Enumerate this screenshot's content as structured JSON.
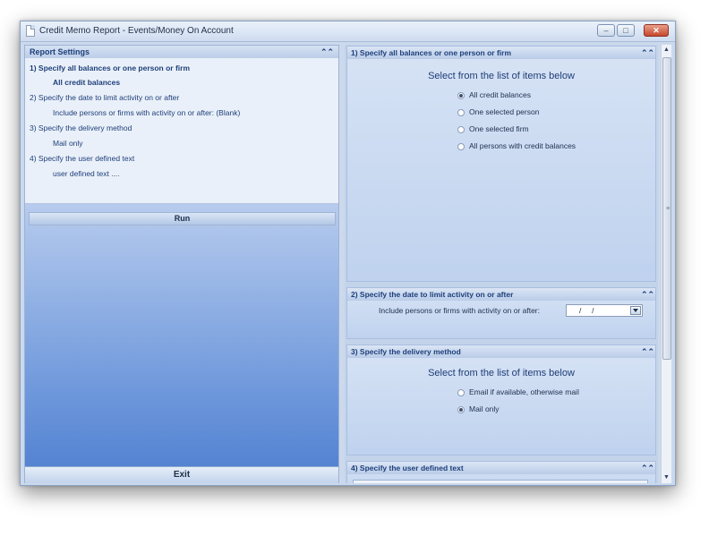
{
  "window": {
    "title": "Credit Memo Report - Events/Money On Account",
    "controls": {
      "minimize": "–",
      "maximize": "□",
      "close": "✕"
    }
  },
  "report_settings": {
    "header": "Report Settings",
    "lines": [
      {
        "text": "1)  Specify all balances or one person or firm",
        "kind": "heading"
      },
      {
        "text": "All credit balances",
        "kind": "value"
      },
      {
        "text": "2)  Specify the date to limit activity on or after",
        "kind": "heading"
      },
      {
        "text": "Include persons or firms with activity on or after:  (Blank)",
        "kind": "value"
      },
      {
        "text": "3)  Specify the delivery method",
        "kind": "heading"
      },
      {
        "text": "Mail only",
        "kind": "value"
      },
      {
        "text": "4)  Specify the user defined text",
        "kind": "heading"
      },
      {
        "text": "user defined text ....",
        "kind": "value"
      }
    ],
    "run_label": "Run",
    "exit_label": "Exit"
  },
  "sections": {
    "s1": {
      "title": "1)  Specify all balances or one person or firm",
      "prompt": "Select from the list of items below",
      "options": [
        {
          "label": "All credit balances",
          "selected": true
        },
        {
          "label": "One selected person",
          "selected": false
        },
        {
          "label": "One selected firm",
          "selected": false
        },
        {
          "label": "All persons with credit balances",
          "selected": false
        }
      ]
    },
    "s2": {
      "title": "2)  Specify the date to limit activity on or after",
      "label": "Include persons or firms with activity on or after:",
      "date_value": "/     /"
    },
    "s3": {
      "title": "3)  Specify the delivery method",
      "prompt": "Select from the list of items below",
      "options": [
        {
          "label": "Email if available, otherwise mail",
          "selected": false
        },
        {
          "label": "Mail only",
          "selected": true
        }
      ]
    },
    "s4": {
      "title": "4)  Specify the user defined text"
    }
  },
  "icons": {
    "collapse": "chevron-double-up-icon",
    "app": "document-icon",
    "scroll_up": "arrow-up-icon",
    "scroll_down": "arrow-down-icon"
  },
  "colors": {
    "accent_text": "#1d3f7a",
    "panel_gradient_bottom": "#4f7fd0",
    "close_button": "#c6462c"
  }
}
